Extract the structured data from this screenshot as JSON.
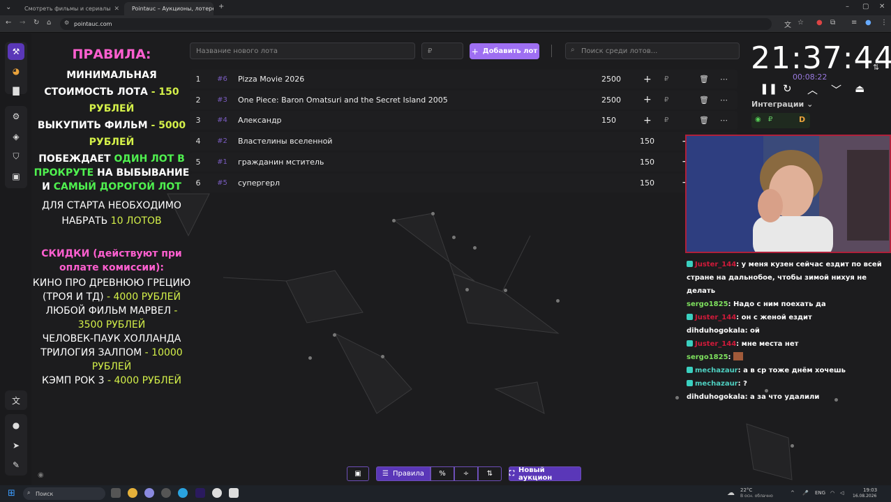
{
  "browser": {
    "tabs": [
      {
        "title": "Смотреть фильмы и сериалы"
      },
      {
        "title": "Pointauc – Аукционы, лотереи"
      }
    ],
    "url": "pointauc.com"
  },
  "rules": {
    "title": "ПРАВИЛА:",
    "min_cost_a": "МИНИМАЛЬНАЯ СТОИМОСТЬ ЛОТА",
    "min_cost_b": " - 150 РУБЛЕЙ",
    "buyout_a": "ВЫКУПИТЬ ФИЛЬМ",
    "buyout_b": " - 5000 РУБЛЕЙ",
    "wins_a": "ПОБЕЖДАЕТ ",
    "wins_b": "ОДИН ЛОТ В ПРОКРУТЕ",
    "wins_c": " НА ВЫБЫВАНИЕ И ",
    "wins_d": "САМЫЙ ДОРОГОЙ ЛОТ",
    "start_a": "ДЛЯ СТАРТА НЕОБХОДИМО НАБРАТЬ ",
    "start_b": "10 ЛОТОВ",
    "discounts_title": "СКИДКИ (действуют при оплате комиссии):",
    "d1_a": "КИНО ПРО ДРЕВНЮЮ ГРЕЦИЮ (ТРОЯ И ТД)",
    "d1_b": " - 4000 РУБЛЕЙ",
    "d2_a": "ЛЮБОЙ ФИЛЬМ МАРВЕЛ",
    "d2_b": " - 3500 РУБЛЕЙ",
    "d3_a": "ЧЕЛОВЕК-ПАУК ХОЛЛАНДА ТРИЛОГИЯ ЗАЛПОМ",
    "d3_b": " - 10000 РУБЛЕЙ",
    "d4_a": "КЭМП РОК 3",
    "d4_b": " - 4000 РУБЛЕЙ"
  },
  "controls": {
    "lot_name_placeholder": "Название нового лота",
    "amount_placeholder": "₽",
    "add_lot_label": "Добавить лот",
    "search_placeholder": "Поиск среди лотов..."
  },
  "lots": [
    {
      "num": "1",
      "id": "#6",
      "name": "Pizza Movie 2026",
      "amount": "2500",
      "currency": "₽"
    },
    {
      "num": "2",
      "id": "#3",
      "name": "One Piece: Baron Omatsuri and the Secret Island 2005",
      "amount": "2500",
      "currency": "₽"
    },
    {
      "num": "3",
      "id": "#4",
      "name": "Александр",
      "amount": "150",
      "currency": "₽"
    },
    {
      "num": "4",
      "id": "#2",
      "name": "Властелины вселенной",
      "amount": "150",
      "currency": "₽"
    },
    {
      "num": "5",
      "id": "#1",
      "name": "гражданин мститель",
      "amount": "150",
      "currency": "₽"
    },
    {
      "num": "6",
      "id": "#5",
      "name": "супергерл",
      "amount": "150",
      "currency": "₽"
    }
  ],
  "timer": {
    "clock": "21:37:44",
    "elapsed": "00:08:22",
    "integrations_label": "Интеграции"
  },
  "chat": [
    {
      "user": "Juster_144",
      "text": ": у меня кузен сейчас ездит по всей стране на дальнобое, чтобы зимой нихуя не делать",
      "color": "red",
      "badge": true
    },
    {
      "user": "sergo1825",
      "text": ": Надо с ним поехать да",
      "color": "green",
      "badge": false
    },
    {
      "user": "Juster_144",
      "text": ": он с женой ездит",
      "color": "red",
      "badge": true
    },
    {
      "user": "dihduhogokala",
      "text": ": ой",
      "color": "white",
      "badge": false
    },
    {
      "user": "Juster_144",
      "text": ": мне места нет",
      "color": "red",
      "badge": true
    },
    {
      "user": "sergo1825",
      "text": ":",
      "color": "green",
      "badge": false
    },
    {
      "user": "mechazaur",
      "text": ": а в ср тоже днём хочешь",
      "color": "teal",
      "badge": true
    },
    {
      "user": "mechazaur",
      "text": ": ?",
      "color": "teal",
      "badge": true
    },
    {
      "user": "dihduhogokala",
      "text": ": а за что удалили",
      "color": "white",
      "badge": false
    }
  ],
  "bottom": {
    "rules_label": "Правила",
    "new_auction_label": "Новый аукцион"
  },
  "taskbar": {
    "search_label": "Поиск",
    "weather_temp": "22°C",
    "weather_desc": "В осн. облачно",
    "lang": "ENG",
    "time": "19:03",
    "date": "16.08.2026"
  }
}
